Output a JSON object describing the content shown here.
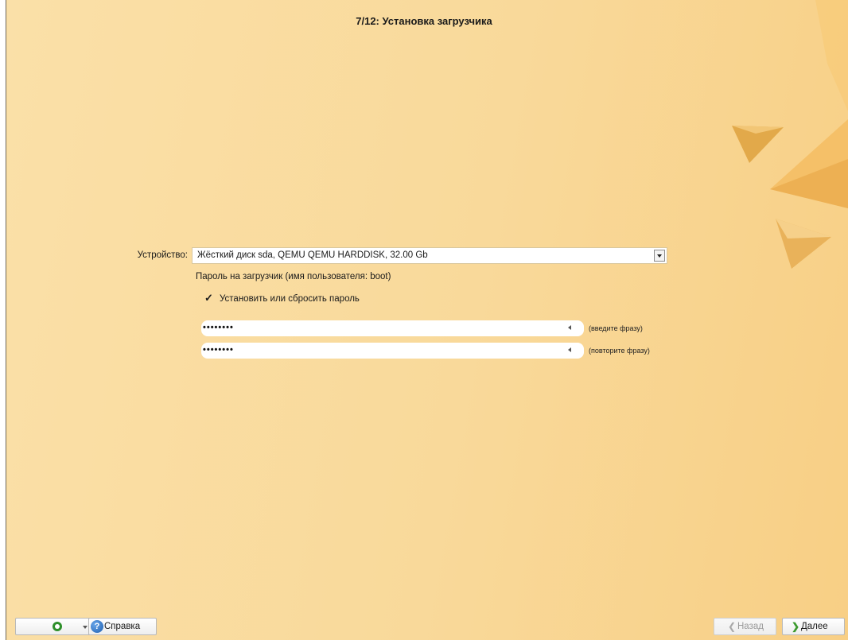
{
  "window": {
    "title": "7/12: Установка загрузчика"
  },
  "form": {
    "device_label": "Устройство:",
    "device_value": "Жёсткий диск sda, QEMU QEMU HARDDISK, 32.00 Gb",
    "password_caption": "Пароль на загрузчик (имя пользователя: boot)",
    "checkbox_mark": "✓",
    "checkbox_label": "Установить или сбросить пароль",
    "checkbox_checked": true,
    "password1_value": "••••••••",
    "password1_hint": "(введите фразу)",
    "password2_value": "••••••••",
    "password2_hint": "(повторите фразу)"
  },
  "bottom_bar": {
    "help_icon_char": "?",
    "help_label": "Справка",
    "back_chevron": "❮",
    "back_label": "Назад",
    "next_chevron": "❯",
    "next_label": "Далее"
  },
  "icons": {
    "menu": "green-circle-icon",
    "menu_dropdown": "chevron-down-icon",
    "help": "help-question-icon",
    "combo_dropdown": "chevron-down-icon",
    "clear": "clear-left-arrow-icon",
    "back": "chevron-left-icon",
    "next": "chevron-right-icon"
  },
  "colors": {
    "background": "#f9d99a",
    "next_accent": "#3c9a2e",
    "help_accent": "#1f5fb0",
    "menu_accent": "#2e8f2a"
  }
}
